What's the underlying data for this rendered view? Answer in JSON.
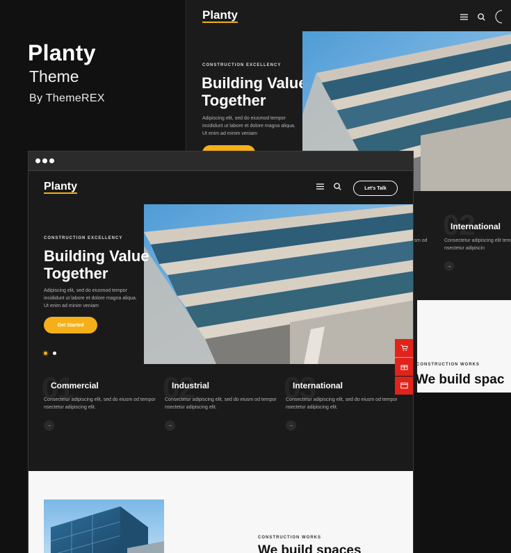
{
  "promo": {
    "title": "Planty",
    "subtitle": "Theme",
    "byline": "By ThemeREX"
  },
  "site": {
    "logo": "Planty",
    "cta": "Let's Talk",
    "hero": {
      "eyebrow": "CONSTRUCTION EXCELLENCY",
      "headline": "Building Value Together",
      "paragraph": "Adipiscing elit, sed do eiusmod tempor incididunt ut labore et dolore magna aliqua. Ut enim ad minim veniam",
      "button": "Get Started",
      "slider_dots": 2,
      "active_dot": 1
    },
    "services": [
      {
        "title": "Commercial",
        "text": "Consectetur adipiscing elit, sed do eiusm od tempor nsectetur adipiscing elit."
      },
      {
        "title": "Industrial",
        "text": "Consectetur adipiscing elit, sed do eiusm od tempor nsectetur adipiscing elit."
      },
      {
        "title": "International",
        "text": "Consectetur adipiscing elit, sed do eiusm od tempor nsectetur adipiscing elit."
      }
    ],
    "back_card": {
      "title": "International",
      "text": "Consectetur adipiscing elit tempor nsectetur adipiscin",
      "partial": "iusm od"
    },
    "works": {
      "eyebrow": "CONSTRUCTION WORKS",
      "headline": "We build spaces"
    },
    "back_works_headline": "We build spac"
  },
  "icons": {
    "menu": "menu-icon",
    "search": "search-icon",
    "arrow": "arrow-right-icon",
    "cart": "cart-icon",
    "gift": "gift-icon",
    "window": "window-icon"
  },
  "colors": {
    "accent": "#f5b019",
    "widget": "#e0241c",
    "background": "#111111"
  }
}
